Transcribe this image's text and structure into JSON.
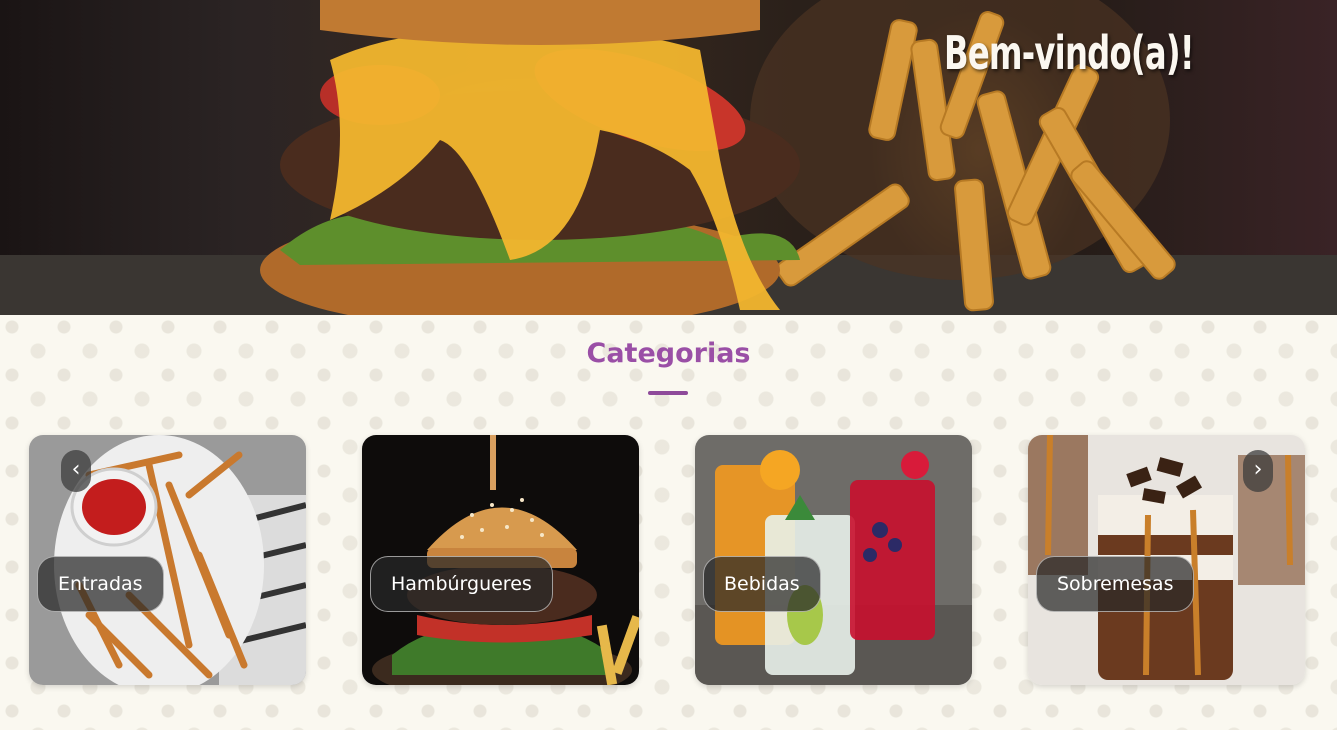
{
  "hero": {
    "title": "Bem-vindo(a)!"
  },
  "categories": {
    "title": "Categorias",
    "items": [
      {
        "label": "Entradas"
      },
      {
        "label": "Hambúrgueres"
      },
      {
        "label": "Bebidas"
      },
      {
        "label": "Sobremesas"
      }
    ]
  },
  "carousel": {
    "prev_icon": "‹",
    "next_icon": "›"
  },
  "colors": {
    "accent": "#9a4fa6",
    "label_bg": "#282828"
  }
}
